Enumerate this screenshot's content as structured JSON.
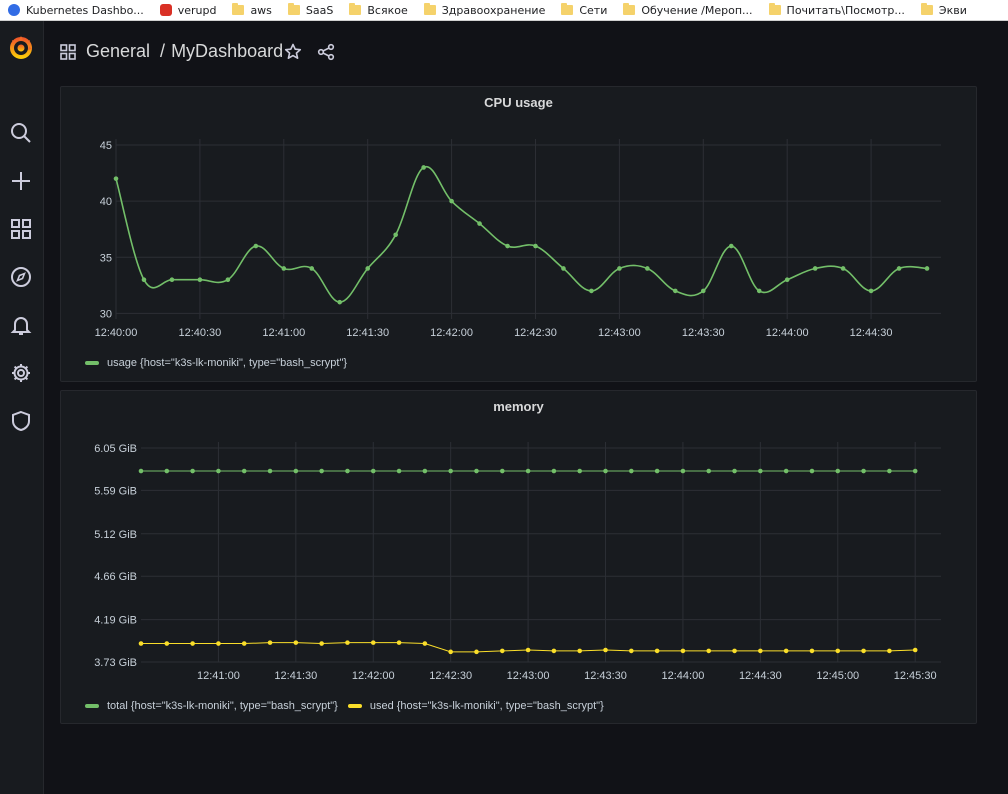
{
  "bookmarks": [
    {
      "label": "Kubernetes Dashbo...",
      "icon": "kubernetes-icon"
    },
    {
      "label": "verupd",
      "icon": "red-app-icon"
    },
    {
      "label": "aws",
      "icon": "folder-icon"
    },
    {
      "label": "SaaS",
      "icon": "folder-icon"
    },
    {
      "label": "Всякое",
      "icon": "folder-icon"
    },
    {
      "label": "Здравоохранение",
      "icon": "folder-icon"
    },
    {
      "label": "Сети",
      "icon": "folder-icon"
    },
    {
      "label": "Обучение /Мероп...",
      "icon": "folder-icon"
    },
    {
      "label": "Почитать\\Посмотр...",
      "icon": "folder-icon"
    },
    {
      "label": "Экви",
      "icon": "folder-icon"
    }
  ],
  "sidebar": {
    "items": [
      "grafana-logo",
      "search-icon",
      "plus-icon",
      "dashboards-icon",
      "explore-icon",
      "alerting-bell-icon",
      "configuration-gear-icon",
      "server-admin-shield-icon"
    ]
  },
  "header": {
    "folder": "General",
    "separator": "/",
    "dashboard": "MyDashboard"
  },
  "colors": {
    "green": "#73bf69",
    "yellow": "#fade2a",
    "grid": "#2c2f35",
    "text": "#c7d0d9"
  },
  "panels": {
    "cpu": {
      "title": "CPU usage",
      "legend": [
        {
          "label": "usage {host=\"k3s-lk-moniki\", type=\"bash_scrypt\"}",
          "color": "#73bf69"
        }
      ]
    },
    "memory": {
      "title": "memory",
      "legend": [
        {
          "label": "total {host=\"k3s-lk-moniki\", type=\"bash_scrypt\"}",
          "color": "#73bf69"
        },
        {
          "label": "used {host=\"k3s-lk-moniki\", type=\"bash_scrypt\"}",
          "color": "#fade2a"
        }
      ]
    }
  },
  "chart_data": [
    {
      "type": "line",
      "title": "CPU usage",
      "x_ticks": [
        "12:40:00",
        "12:40:30",
        "12:41:00",
        "12:41:30",
        "12:42:00",
        "12:42:30",
        "12:43:00",
        "12:43:30",
        "12:44:00",
        "12:44:30"
      ],
      "y_ticks": [
        "30",
        "35",
        "40",
        "45"
      ],
      "ylim": [
        29.5,
        45
      ],
      "x_range_seconds": [
        0,
        295
      ],
      "x_interval_seconds": 10,
      "x_start": "12:40:00",
      "grid": true,
      "legend_position": "bottom-left",
      "series": [
        {
          "name": "usage {host=\"k3s-lk-moniki\", type=\"bash_scrypt\"}",
          "color": "#73bf69",
          "values": [
            42,
            33,
            33,
            33,
            33,
            36,
            34,
            34,
            31,
            34,
            37,
            43,
            40,
            38,
            36,
            36,
            34,
            32,
            34,
            34,
            32,
            32,
            36,
            32,
            33,
            34,
            34,
            32,
            34,
            34
          ]
        }
      ]
    },
    {
      "type": "line",
      "title": "memory",
      "x_ticks": [
        "12:41:00",
        "12:41:30",
        "12:42:00",
        "12:42:30",
        "12:43:00",
        "12:43:30",
        "12:44:00",
        "12:44:30",
        "12:45:00",
        "12:45:30"
      ],
      "y_ticks": [
        "3.73 GiB",
        "4.19 GiB",
        "4.66 GiB",
        "5.12 GiB",
        "5.59 GiB",
        "6.05 GiB"
      ],
      "ylim": [
        3.73,
        6.05
      ],
      "x_range_seconds": [
        0,
        310
      ],
      "x_interval_seconds": 10,
      "x_start": "12:40:30",
      "grid": true,
      "legend_position": "bottom-left",
      "series": [
        {
          "name": "total {host=\"k3s-lk-moniki\", type=\"bash_scrypt\"}",
          "color": "#73bf69",
          "values": [
            5.8,
            5.8,
            5.8,
            5.8,
            5.8,
            5.8,
            5.8,
            5.8,
            5.8,
            5.8,
            5.8,
            5.8,
            5.8,
            5.8,
            5.8,
            5.8,
            5.8,
            5.8,
            5.8,
            5.8,
            5.8,
            5.8,
            5.8,
            5.8,
            5.8,
            5.8,
            5.8,
            5.8,
            5.8,
            5.8,
            5.8
          ]
        },
        {
          "name": "used {host=\"k3s-lk-moniki\", type=\"bash_scrypt\"}",
          "color": "#fade2a",
          "values": [
            3.93,
            3.93,
            3.93,
            3.93,
            3.93,
            3.94,
            3.94,
            3.93,
            3.94,
            3.94,
            3.94,
            3.93,
            3.84,
            3.84,
            3.85,
            3.86,
            3.85,
            3.85,
            3.86,
            3.85,
            3.85,
            3.85,
            3.85,
            3.85,
            3.85,
            3.85,
            3.85,
            3.85,
            3.85,
            3.85,
            3.86
          ]
        }
      ]
    }
  ]
}
